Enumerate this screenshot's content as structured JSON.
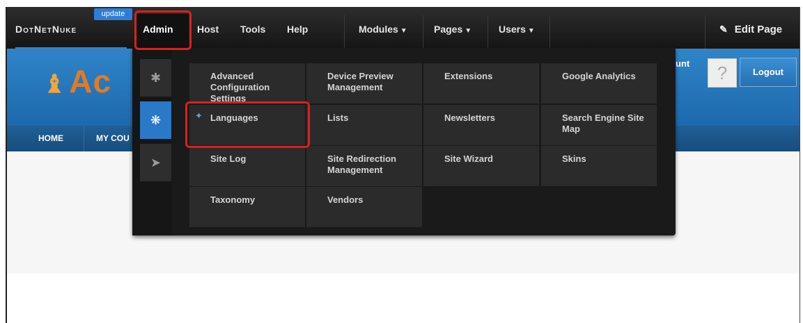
{
  "controlbar": {
    "brand": "DotNetNuke",
    "update_badge": "update",
    "admin": "Admin",
    "host": "Host",
    "tools": "Tools",
    "help": "Help",
    "modules": "Modules",
    "pages": "Pages",
    "users": "Users",
    "edit_page": "Edit Page"
  },
  "site": {
    "logo_text": "Ac",
    "account_text": "unt",
    "logout": "Logout",
    "nav": [
      "HOME",
      "MY COU"
    ]
  },
  "admin_menu": {
    "side_tabs": [
      "gear-icon",
      "gears-icon",
      "pin-icon"
    ],
    "items": [
      "Advanced Configuration Settings",
      "Device Preview Management",
      "Extensions",
      "Google Analytics",
      "Languages",
      "Lists",
      "Newsletters",
      "Search Engine Site Map",
      "Site Log",
      "Site Redirection Management",
      "Site Wizard",
      "Skins",
      "Taxonomy",
      "Vendors"
    ]
  },
  "colors": {
    "accent_blue": "#2a78c8",
    "highlight_red": "#d92020",
    "header_blue": "#2f84c8"
  }
}
